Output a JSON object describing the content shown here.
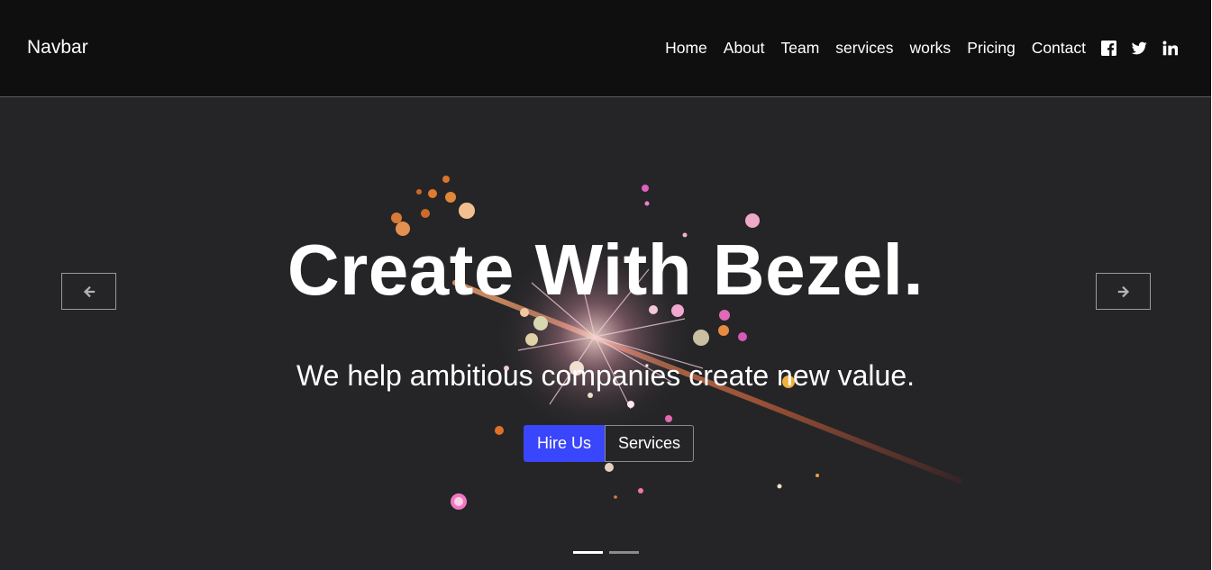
{
  "navbar": {
    "brand": "Navbar",
    "links": [
      "Home",
      "About",
      "Team",
      "services",
      "works",
      "Pricing",
      "Contact"
    ],
    "social_icons": [
      "facebook-icon",
      "twitter-icon",
      "linkedin-icon"
    ]
  },
  "hero": {
    "title": "Create With Bezel.",
    "subtitle": "We help ambitious companies create new value.",
    "primary_button": "Hire Us",
    "secondary_button": "Services",
    "prev_icon": "arrow-left-icon",
    "next_icon": "arrow-right-icon",
    "slide_count": 2,
    "active_slide": 1
  },
  "colors": {
    "navbar_bg": "#0f0f10",
    "hero_bg": "#252527",
    "primary": "#3a46fb",
    "text": "#ffffff"
  }
}
